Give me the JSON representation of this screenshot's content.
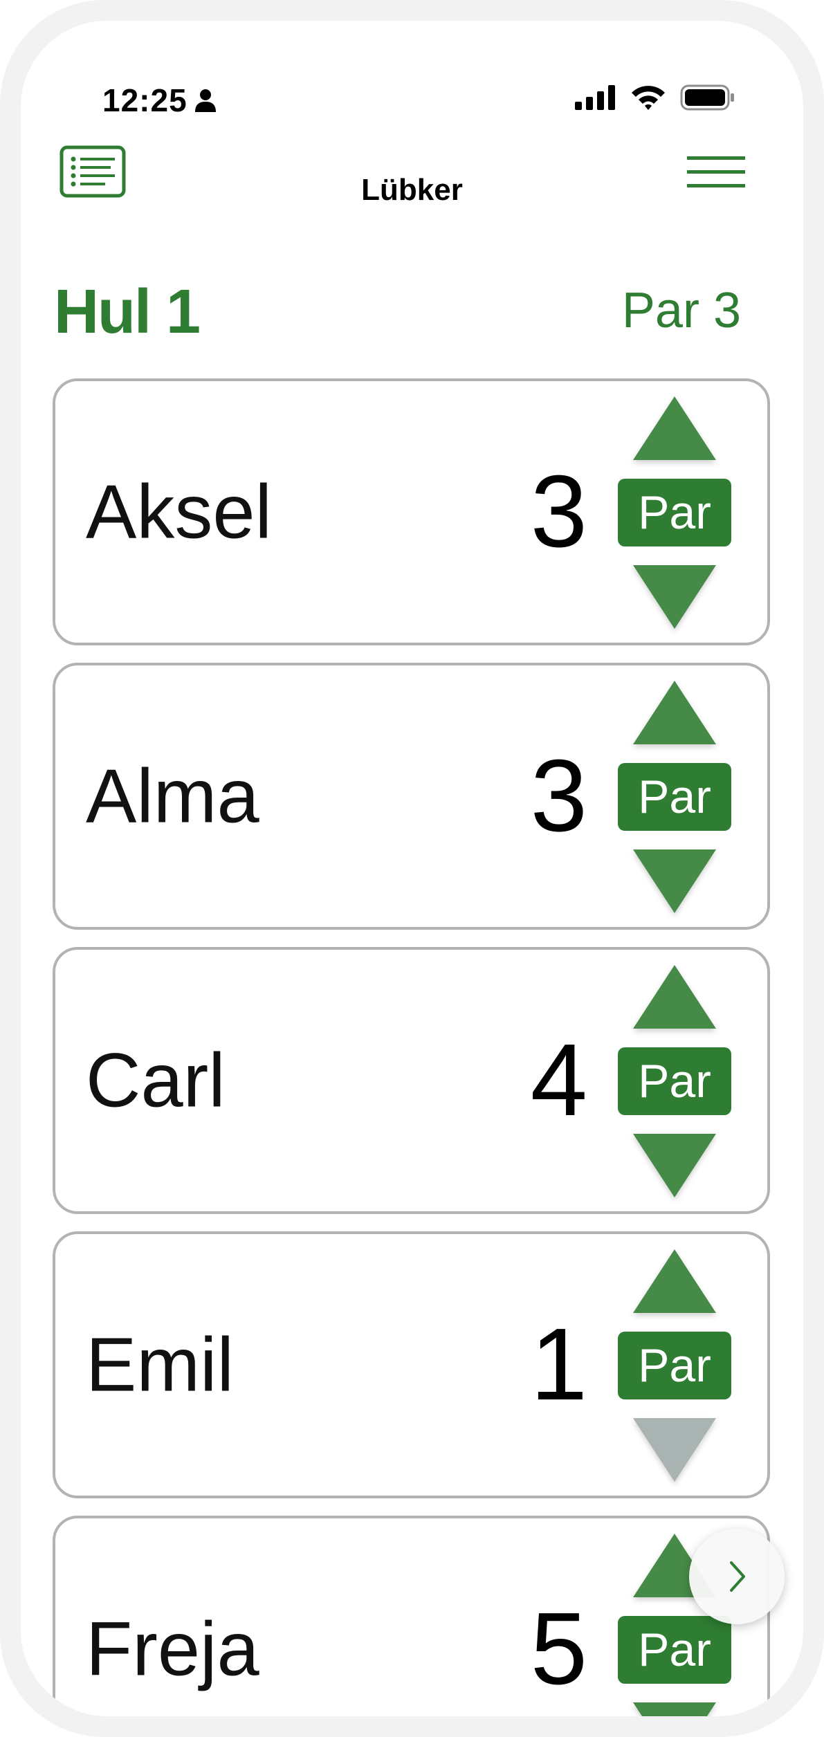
{
  "status_bar": {
    "time": "12:25",
    "icons": [
      "person-icon",
      "cellular-signal-icon",
      "wifi-icon",
      "battery-icon"
    ]
  },
  "nav": {
    "title": "Lübker",
    "left_icon": "scorecard-list-icon",
    "right_icon": "hamburger-menu-icon"
  },
  "hole": {
    "title": "Hul 1",
    "par": "Par 3"
  },
  "players": [
    {
      "name": "Aksel",
      "score": "3",
      "par_label": "Par",
      "decrement_enabled": true
    },
    {
      "name": "Alma",
      "score": "3",
      "par_label": "Par",
      "decrement_enabled": true
    },
    {
      "name": "Carl",
      "score": "4",
      "par_label": "Par",
      "decrement_enabled": true
    },
    {
      "name": "Emil",
      "score": "1",
      "par_label": "Par",
      "decrement_enabled": false
    },
    {
      "name": "Freja",
      "score": "5",
      "par_label": "Par",
      "decrement_enabled": true
    }
  ],
  "next_button": {
    "icon": "chevron-right-icon"
  },
  "colors": {
    "accent": "#2e7d32",
    "arrow": "#468a47",
    "arrow_disabled": "#a8b3b2",
    "card_border": "#b3b3b3",
    "frame": "#f2f2f2"
  }
}
